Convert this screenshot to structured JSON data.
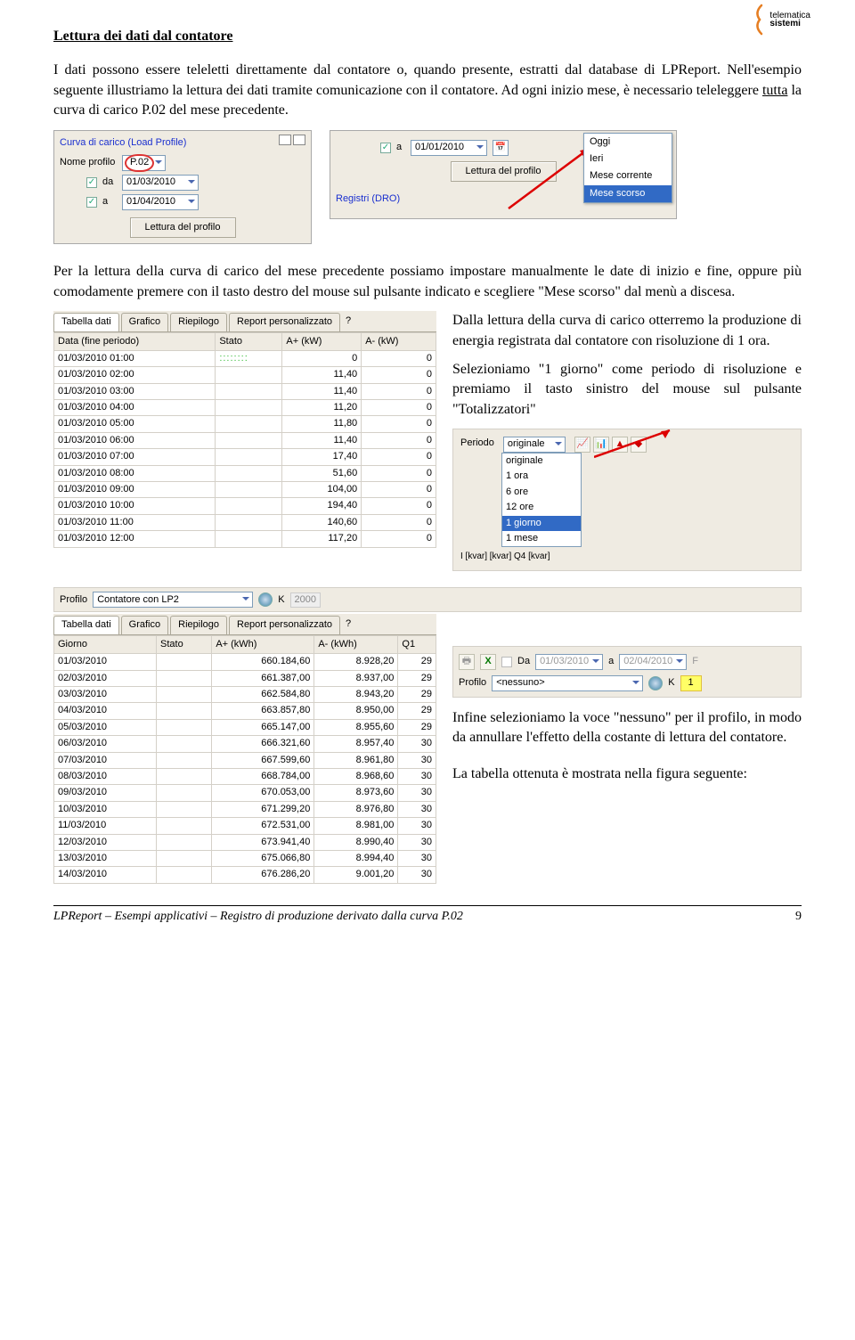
{
  "brand": {
    "word1": "telematica",
    "word2": "sistemi"
  },
  "heading": "Lettura dei dati dal contatore",
  "para1_a": "I dati possono essere teleletti direttamente dal contatore o, quando presente, estratti dal database di LPReport. Nell'esempio seguente illustriamo la lettura dei dati tramite comunicazione con il contatore. Ad ogni inizio mese, è necessario teleleggere ",
  "para1_u": "tutta",
  "para1_b": " la curva di carico P.02 del mese precedente.",
  "shot1": {
    "title": "Curva di carico (Load Profile)",
    "nome_profilo_label": "Nome profilo",
    "nome_profilo_val": "P.02",
    "da_label": "da",
    "da_val": "01/03/2010",
    "a_label": "a",
    "a_val": "01/04/2010",
    "btn": "Lettura del profilo"
  },
  "shot2": {
    "a_label": "a",
    "a_val": "01/01/2010",
    "btn": "Lettura del profilo",
    "reg": "Registri (DRO)",
    "menu": [
      "Oggi",
      "Ieri",
      "Mese corrente",
      "Mese scorso"
    ]
  },
  "para2": "Per la lettura della curva di carico del mese precedente possiamo impostare manualmente le date di inizio e fine, oppure più comodamente premere con il tasto destro del mouse sul pulsante indicato e scegliere \"Mese scorso\" dal menù a discesa.",
  "para3": "Dalla lettura della curva di carico otterremo la produzione di energia registrata dal contatore con risoluzione di 1 ora.",
  "para4": "Selezioniamo \"1 giorno\" come periodo di risoluzione e premiamo il tasto sinistro del mouse sul pulsante \"Totalizzatori\"",
  "tab_labels": [
    "Tabella dati",
    "Grafico",
    "Riepilogo",
    "Report personalizzato"
  ],
  "help_glyph": "?",
  "table1": {
    "headers": [
      "Data (fine periodo)",
      "Stato",
      "A+ (kW)",
      "A- (kW)"
    ],
    "rows": [
      [
        "01/03/2010 01:00",
        "0",
        "0"
      ],
      [
        "01/03/2010 02:00",
        "11,40",
        "0"
      ],
      [
        "01/03/2010 03:00",
        "11,40",
        "0"
      ],
      [
        "01/03/2010 04:00",
        "11,20",
        "0"
      ],
      [
        "01/03/2010 05:00",
        "11,80",
        "0"
      ],
      [
        "01/03/2010 06:00",
        "11,40",
        "0"
      ],
      [
        "01/03/2010 07:00",
        "17,40",
        "0"
      ],
      [
        "01/03/2010 08:00",
        "51,60",
        "0"
      ],
      [
        "01/03/2010 09:00",
        "104,00",
        "0"
      ],
      [
        "01/03/2010 10:00",
        "194,40",
        "0"
      ],
      [
        "01/03/2010 11:00",
        "140,60",
        "0"
      ],
      [
        "01/03/2010 12:00",
        "117,20",
        "0"
      ]
    ]
  },
  "periodo": {
    "label": "Periodo",
    "selected": "originale",
    "opts": [
      "originale",
      "1 ora",
      "6 ore",
      "12 ore",
      "1 giorno",
      "1 mese"
    ],
    "footer": "I [kvar]           [kvar]   Q4 [kvar]"
  },
  "profile_row": {
    "label": "Profilo",
    "val": "Contatore con LP2",
    "k": "K",
    "kval": "2000"
  },
  "table2": {
    "headers": [
      "Giorno",
      "Stato",
      "A+ (kWh)",
      "A- (kWh)",
      "Q1"
    ],
    "rows": [
      [
        "01/03/2010",
        "660.184,60",
        "8.928,20",
        "29"
      ],
      [
        "02/03/2010",
        "661.387,00",
        "8.937,00",
        "29"
      ],
      [
        "03/03/2010",
        "662.584,80",
        "8.943,20",
        "29"
      ],
      [
        "04/03/2010",
        "663.857,80",
        "8.950,00",
        "29"
      ],
      [
        "05/03/2010",
        "665.147,00",
        "8.955,60",
        "29"
      ],
      [
        "06/03/2010",
        "666.321,60",
        "8.957,40",
        "30"
      ],
      [
        "07/03/2010",
        "667.599,60",
        "8.961,80",
        "30"
      ],
      [
        "08/03/2010",
        "668.784,00",
        "8.968,60",
        "30"
      ],
      [
        "09/03/2010",
        "670.053,00",
        "8.973,60",
        "30"
      ],
      [
        "10/03/2010",
        "671.299,20",
        "8.976,80",
        "30"
      ],
      [
        "11/03/2010",
        "672.531,00",
        "8.981,00",
        "30"
      ],
      [
        "12/03/2010",
        "673.941,40",
        "8.990,40",
        "30"
      ],
      [
        "13/03/2010",
        "675.066,80",
        "8.994,40",
        "30"
      ],
      [
        "14/03/2010",
        "676.286,20",
        "9.001,20",
        "30"
      ]
    ]
  },
  "toolbar": {
    "da": "Da",
    "da_val": "01/03/2010",
    "a": "a",
    "a_val": "02/04/2010",
    "profilo": "Profilo",
    "profilo_val": "<nessuno>",
    "k": "K",
    "kval": "1",
    "print_glyph": "🖶",
    "excel_glyph": "X"
  },
  "para5": "Infine selezioniamo la voce \"nessuno\" per il profilo, in modo da annullare l'effetto della costante di lettura del contatore.",
  "para6": "La tabella ottenuta è mostrata nella figura seguente:",
  "footer": {
    "left": "LPReport – Esempi applicativi – Registro di produzione derivato dalla curva P.02",
    "page": "9"
  }
}
